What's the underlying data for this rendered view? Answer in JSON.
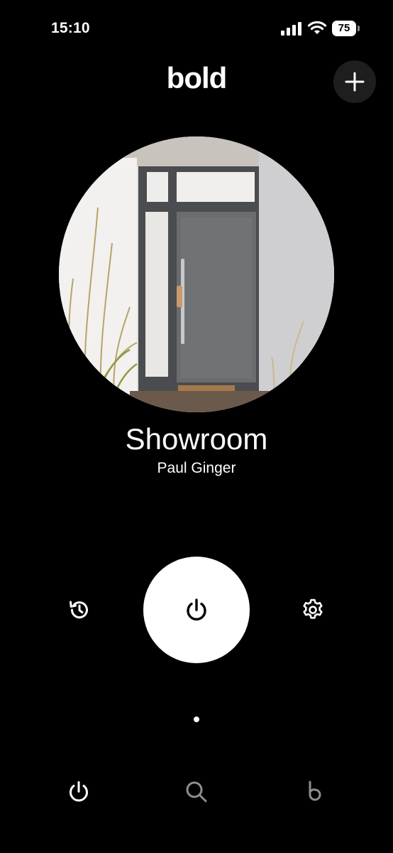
{
  "status_bar": {
    "time": "15:10",
    "battery": "75",
    "icons": [
      "signal-icon",
      "wifi-icon",
      "battery-icon"
    ]
  },
  "header": {
    "logo": "bold",
    "add_icon": "plus-icon"
  },
  "lock": {
    "name": "Showroom",
    "owner": "Paul Ginger",
    "photo": "front-door-photo"
  },
  "controls": {
    "left_icon": "history-icon",
    "center_icon": "power-icon",
    "right_icon": "gear-icon"
  },
  "pagination": {
    "pages": 1,
    "current": 1
  },
  "tab_bar": {
    "items": [
      {
        "icon": "power-icon",
        "active": true
      },
      {
        "icon": "search-icon",
        "active": false
      },
      {
        "icon": "bold-b-icon",
        "active": false
      }
    ]
  },
  "colors": {
    "background": "#000000",
    "foreground": "#ffffff",
    "inactive_tab": "#8e8e8e",
    "add_button_bg": "#1e1e1e"
  }
}
